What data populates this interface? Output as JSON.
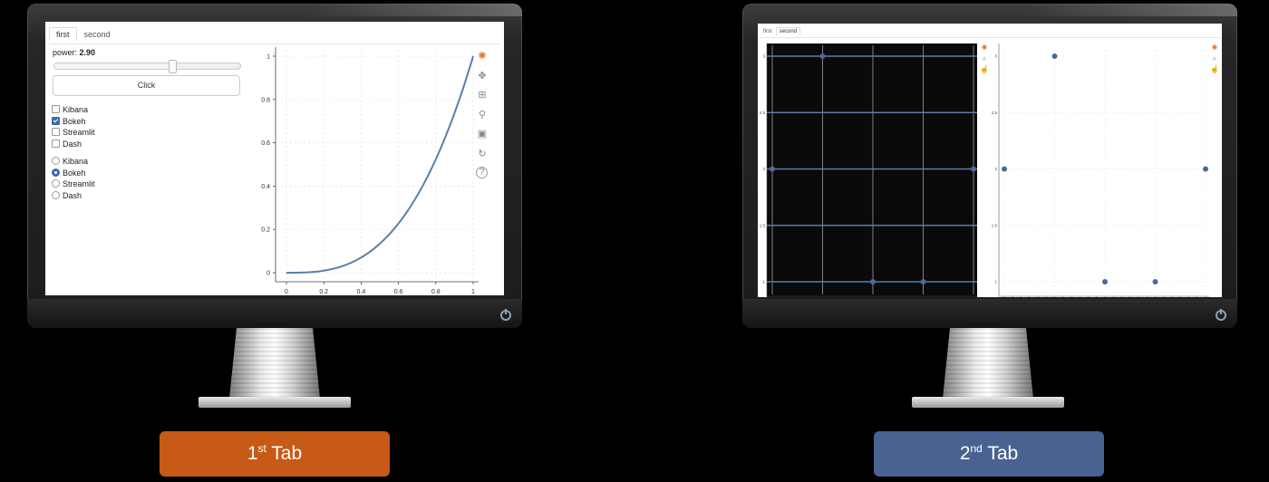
{
  "monitor1": {
    "tabs": [
      {
        "label": "first",
        "active": true
      },
      {
        "label": "second",
        "active": false
      }
    ],
    "slider": {
      "label": "power:",
      "value": "2.90",
      "min": 1,
      "max": 4
    },
    "button_label": "Click",
    "checkboxes": [
      {
        "label": "Kibana",
        "checked": false
      },
      {
        "label": "Bokeh",
        "checked": true
      },
      {
        "label": "Streamlit",
        "checked": false
      },
      {
        "label": "Dash",
        "checked": false
      }
    ],
    "radios": [
      {
        "label": "Kibana",
        "selected": false
      },
      {
        "label": "Bokeh",
        "selected": true
      },
      {
        "label": "Streamlit",
        "selected": false
      },
      {
        "label": "Dash",
        "selected": false
      }
    ],
    "toolbar_icons": [
      "bokeh-logo-icon",
      "pan-icon",
      "box-zoom-icon",
      "wheel-zoom-icon",
      "save-icon",
      "reset-icon",
      "help-icon"
    ]
  },
  "monitor2": {
    "tabs": [
      {
        "label": "first",
        "active": false
      },
      {
        "label": "second",
        "active": true
      }
    ],
    "toolbar_icons_left": [
      "bokeh-logo-icon",
      "lasso-select-icon",
      "tap-icon"
    ],
    "toolbar_icons_right": [
      "bokeh-logo-icon",
      "lasso-select-icon",
      "tap-icon"
    ]
  },
  "captions": {
    "tab1": {
      "base": "1",
      "sup": "st",
      "rest": " Tab",
      "color": "#c65a16"
    },
    "tab2": {
      "base": "2",
      "sup": "nd",
      "rest": " Tab",
      "color": "#4a6291"
    }
  },
  "chart_data": [
    {
      "type": "line",
      "function": "y = x^2.90",
      "x": [
        0,
        0.1,
        0.2,
        0.3,
        0.4,
        0.5,
        0.6,
        0.7,
        0.8,
        0.9,
        1.0
      ],
      "y": [
        0,
        0.0013,
        0.0094,
        0.0305,
        0.0701,
        0.134,
        0.2274,
        0.3552,
        0.5235,
        0.7366,
        1.0
      ],
      "xticks": [
        "0",
        "0.2",
        "0.4",
        "0.6",
        "0.8",
        "1"
      ],
      "yticks": [
        "0",
        "0.2",
        "0.4",
        "0.6",
        "0.8",
        "1"
      ],
      "xlim": [
        0,
        1
      ],
      "ylim": [
        0,
        1
      ],
      "grid": true
    },
    {
      "type": "scatter",
      "background": "#0a0a0a",
      "x": [
        1,
        2,
        3,
        4,
        5
      ],
      "y": [
        2,
        3,
        1,
        1,
        2
      ],
      "yticks": [
        "1",
        "1.5",
        "2",
        "2.5",
        "3"
      ],
      "ylim": [
        1,
        3
      ],
      "grid": true
    },
    {
      "type": "scatter",
      "background": "#ffffff",
      "x": [
        1,
        2,
        3,
        4,
        5
      ],
      "y": [
        2,
        3,
        1,
        1,
        2
      ],
      "yticks": [
        "1",
        "1.5",
        "2",
        "2.5",
        "3"
      ],
      "ylim": [
        1,
        3
      ],
      "grid": true
    }
  ]
}
